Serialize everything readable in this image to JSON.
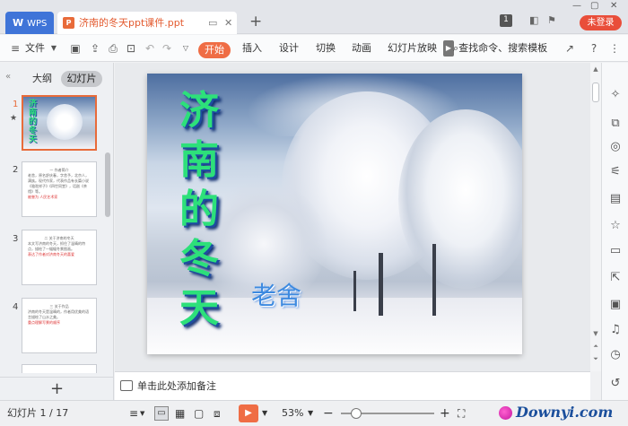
{
  "titlebar": {
    "app_tab": "WPS",
    "doc_tab": "济南的冬天ppt课件.ppt",
    "login": "未登录",
    "page_count_badge": "1"
  },
  "ribbon": {
    "file": "文件",
    "tabs": [
      "开始",
      "插入",
      "设计",
      "切换",
      "动画",
      "幻灯片放映"
    ],
    "search": "查找命令、搜索模板"
  },
  "left_panel": {
    "tabs": [
      "大纲",
      "幻灯片"
    ],
    "slide_numbers": [
      "1",
      "2",
      "3",
      "4"
    ],
    "thumb2_title": "一 作者简介",
    "thumb2_body": "老舍，原名舒庆春，字舍予，北京人，满族。现代作家，代表作品有长篇小说《骆驼祥子》《四世同堂》，话剧《茶馆》等。",
    "thumb2_red": "被誉为 人民艺术家",
    "thumb3_title": "二 关于济南的冬天",
    "thumb3_body": "本文写济南的冬天，抓住了温晴的特点，描绘了一幅幅冬景图画。",
    "thumb3_red": "表达了作者对济南冬天的喜爱",
    "thumb4_title": "三 关于作品",
    "thumb4_body": "济南的冬天是温晴的，作者用优美的语言描绘了山水之美。",
    "thumb4_red": "重点理解写景的顺序"
  },
  "slide": {
    "title": "济南的冬天",
    "author": "老舍"
  },
  "notes": {
    "placeholder": "单击此处添加备注"
  },
  "status": {
    "slide_indicator": "幻灯片 1 / 17",
    "zoom": "53%",
    "zoom_level": 0.16
  },
  "watermark": {
    "text": "Downyi.com"
  },
  "colors": {
    "accent": "#ef6d45",
    "app_blue": "#3f74d8",
    "login_red": "#e94e3a"
  }
}
